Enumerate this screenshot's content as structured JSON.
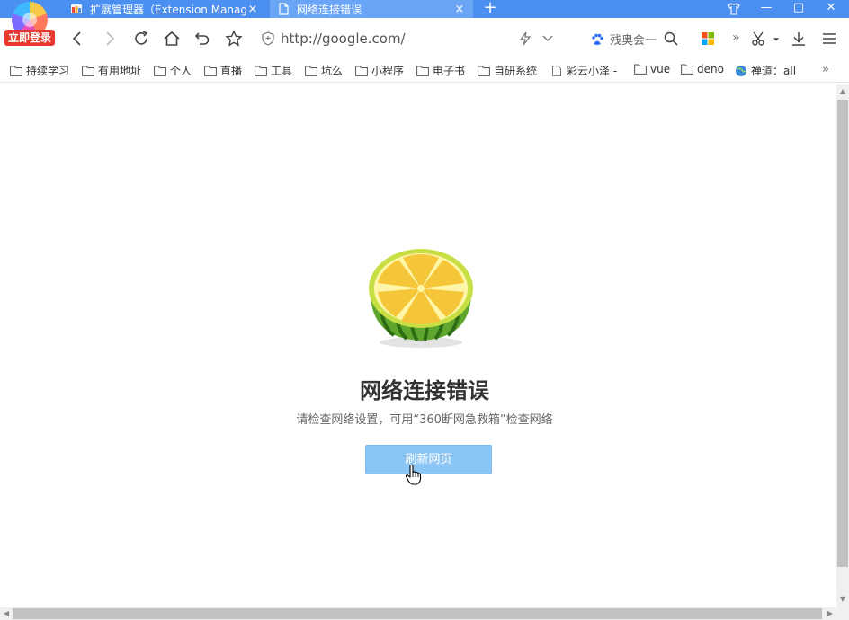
{
  "login": {
    "label": "立即登录"
  },
  "tabs": [
    {
      "title": "扩展管理器（Extension Manager）",
      "close": "×"
    },
    {
      "title": "网络连接错误",
      "close": "×"
    }
  ],
  "new_tab": "+",
  "window": {
    "minimize": "—",
    "maximize": "□",
    "close": "✕"
  },
  "address": {
    "url": "http://google.com/"
  },
  "search": {
    "engine_text": "残奥会一"
  },
  "nav_more": "»",
  "bookmarks": [
    {
      "label": "持续学习",
      "icon": "folder-icon"
    },
    {
      "label": "有用地址",
      "icon": "folder-icon"
    },
    {
      "label": "个人",
      "icon": "folder-icon"
    },
    {
      "label": "直播",
      "icon": "folder-icon"
    },
    {
      "label": "工具",
      "icon": "folder-icon"
    },
    {
      "label": "坑么",
      "icon": "folder-icon"
    },
    {
      "label": "小程序",
      "icon": "folder-icon"
    },
    {
      "label": "电子书",
      "icon": "folder-icon"
    },
    {
      "label": "自研系统",
      "icon": "folder-icon"
    },
    {
      "label": "彩云小泽 -",
      "icon": "page-icon"
    },
    {
      "label": "vue",
      "icon": "folder-icon"
    },
    {
      "label": "deno",
      "icon": "folder-icon"
    },
    {
      "label": "禅道：all",
      "icon": "globe-icon"
    }
  ],
  "bookmarks_more": "»",
  "error": {
    "title": "网络连接错误",
    "description": "请检查网络设置，可用“360断网急救箱”检查网络",
    "refresh_label": "刷新网页"
  },
  "colors": {
    "tabbar": "#4b8ff0",
    "active_tab": "#6aa5f5",
    "login": "#e6382d",
    "button": "#8cc6f5"
  }
}
